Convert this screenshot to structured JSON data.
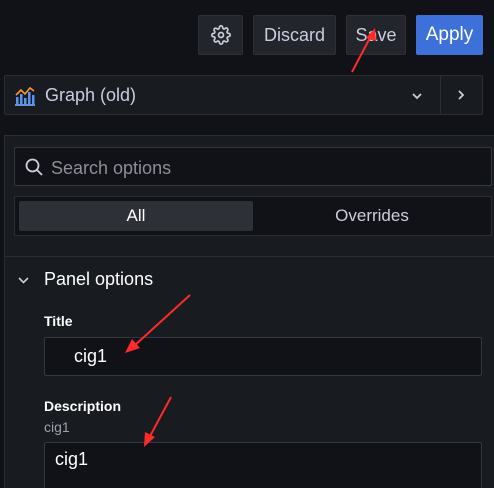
{
  "toolbar": {
    "gear_icon": "gear-icon",
    "discard_label": "Discard",
    "save_label": "Save",
    "apply_label": "Apply",
    "apply_color": "#3d71d9"
  },
  "visualization": {
    "icon": "graph-icon",
    "name": "Graph (old)"
  },
  "search": {
    "placeholder": "Search options"
  },
  "tabs": [
    {
      "label": "All",
      "active": true
    },
    {
      "label": "Overrides",
      "active": false
    }
  ],
  "panel_options": {
    "section_title": "Panel options",
    "title_field": {
      "label": "Title",
      "value": "cig1"
    },
    "description_field": {
      "label": "Description",
      "hint": "cig1",
      "value": "cig1"
    }
  },
  "annotation_color": "#ff2a2a"
}
